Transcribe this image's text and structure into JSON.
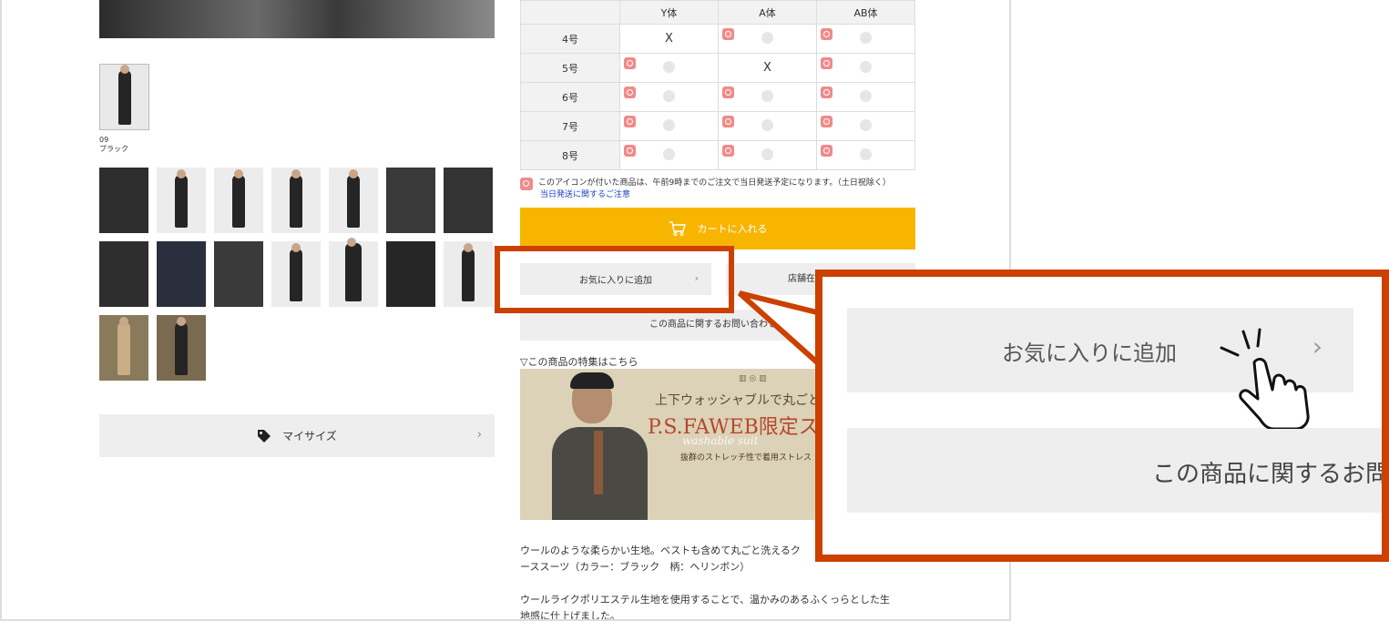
{
  "product": {
    "color_code": "09",
    "color_name": "ブラック"
  },
  "size_button": {
    "label": "マイサイズ",
    "icon": "tag-icon",
    "chevron": "›"
  },
  "stock_table": {
    "columns": [
      "Y体",
      "A体",
      "AB体"
    ],
    "rows": [
      {
        "size": "4号",
        "cells": [
          "X",
          "clock",
          "clock"
        ]
      },
      {
        "size": "5号",
        "cells": [
          "clock",
          "X",
          "clock"
        ]
      },
      {
        "size": "6号",
        "cells": [
          "clock",
          "clock",
          "clock"
        ]
      },
      {
        "size": "7号",
        "cells": [
          "clock",
          "clock",
          "clock"
        ]
      },
      {
        "size": "8号",
        "cells": [
          "clock",
          "clock",
          "clock"
        ]
      }
    ]
  },
  "same_day_note": {
    "text": "このアイコンが付いた商品は、午前9時までのご注文で当日発送予定になります。（土日祝除く）",
    "link": "当日発送に関するご注意"
  },
  "cart_button": {
    "label": "カートに入れる",
    "icon": "cart-icon"
  },
  "favorite_button": {
    "label": "お気に入りに追加",
    "chevron": "›"
  },
  "store_button": {
    "label": "店舗在"
  },
  "inquiry_button": {
    "label": "この商品に関するお問い合わせは"
  },
  "feature_label": "▽この商品の特集はこちら",
  "banner": {
    "sub": "上下ウォッシャブルで丸ごと",
    "title": "P.S.FAWEB限定ス",
    "script": "washable suit",
    "tagline": "抜群のストレッチ性で着用ストレス"
  },
  "description": {
    "p1_line1": "ウールのような柔らかい生地。ベストも含めて丸ごと洗えるク",
    "p1_line2": "ーススーツ（カラー：ブラック　柄：ヘリンボン）",
    "p2_line1": "ウールライクポリエステル生地を使用することで、温かみのあるふくっらとした生",
    "p2_line2": "地感に仕上げました。"
  },
  "zoom": {
    "favorite_label": "お気に入りに追加",
    "chevron": "›",
    "inquiry_label": "この商品に関するお問"
  },
  "colors": {
    "accent": "#cc4000",
    "cart": "#f7b500",
    "clock": "#f08a8a",
    "link": "#1a3fc9"
  }
}
